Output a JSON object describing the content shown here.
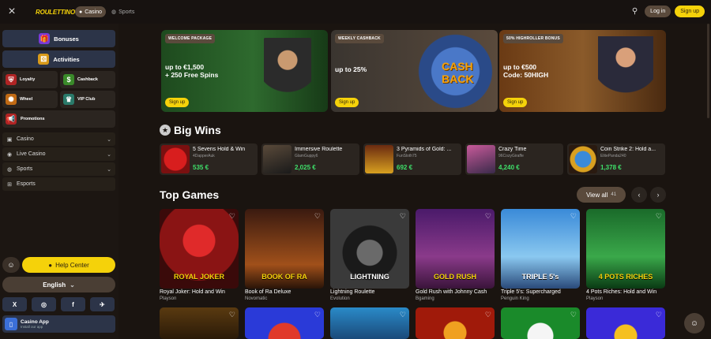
{
  "topbar": {
    "close_icon": "×",
    "logo": "ROULETTINO",
    "tabs": [
      {
        "label": "Casino",
        "icon": "casino-chip-icon"
      },
      {
        "label": "Sports",
        "icon": "ball-icon"
      }
    ],
    "login": "Log in",
    "signup": "Sign up"
  },
  "sidebar": {
    "bonuses": "Bonuses",
    "activities": "Activities",
    "tiles": [
      "Loyalty",
      "Cashback",
      "Wheel",
      "VIP Club",
      "Promotions"
    ],
    "rows": [
      "Casino",
      "Live Casino",
      "Sports",
      "Esports"
    ],
    "help": "Help Center",
    "language": "English",
    "social": [
      "X",
      "◎",
      "f",
      "✈"
    ],
    "app_title": "Casino App",
    "app_sub": "Install our app"
  },
  "promos": [
    {
      "badge": "WELCOME PACKAGE",
      "line1": "up to €1,500",
      "line2": "+ 250 Free Spins",
      "cta": "Sign up"
    },
    {
      "badge": "WEEKLY CASHBACK",
      "line1": "up to 25%",
      "line2": "",
      "cta": "Sign up",
      "art": "CASH BACK"
    },
    {
      "badge": "50% HIGHROLLER BONUS",
      "line1": "up to €500",
      "line2": "Code: 50HIGH",
      "cta": "Sign up"
    }
  ],
  "big_wins": {
    "title": "Big Wins",
    "items": [
      {
        "game": "5 Sevens Hold & Win",
        "user": "4DapperAuk",
        "amount": "535 €"
      },
      {
        "game": "Immersive Roulette",
        "user": "GlamGuppy6",
        "amount": "2,025 €"
      },
      {
        "game": "3 Pyramids of Gold: ...",
        "user": "FunSloth75",
        "amount": "692 €"
      },
      {
        "game": "Crazy Time",
        "user": "96CozyGiraffe",
        "amount": "4,240 €"
      },
      {
        "game": "Coin Strike 2: Hold a...",
        "user": "ElitePanda240",
        "amount": "1,378 €"
      }
    ]
  },
  "top_games": {
    "title": "Top Games",
    "view_all": "View all",
    "count": "41",
    "games": [
      {
        "name": "Royal Joker: Hold and Win",
        "provider": "Playson",
        "art": "ROYAL JOKER"
      },
      {
        "name": "Book of Ra Deluxe",
        "provider": "Novomatic",
        "art": "BOOK OF RA"
      },
      {
        "name": "Lightning Roulette",
        "provider": "Evolution",
        "art": "LIGHTNING"
      },
      {
        "name": "Gold Rush with Johnny Cash",
        "provider": "Bgaming",
        "art": "GOLD RUSH"
      },
      {
        "name": "Triple 5's: Supercharged",
        "provider": "Penguin King",
        "art": "TRIPLE 5's"
      },
      {
        "name": "4 Pots Riches: Hold and Win",
        "provider": "Playson",
        "art": "4 POTS RICHES"
      }
    ]
  },
  "colors": {
    "accent": "#f5d20a",
    "win_amount": "#3ee06a",
    "bg": "#1a1410"
  }
}
